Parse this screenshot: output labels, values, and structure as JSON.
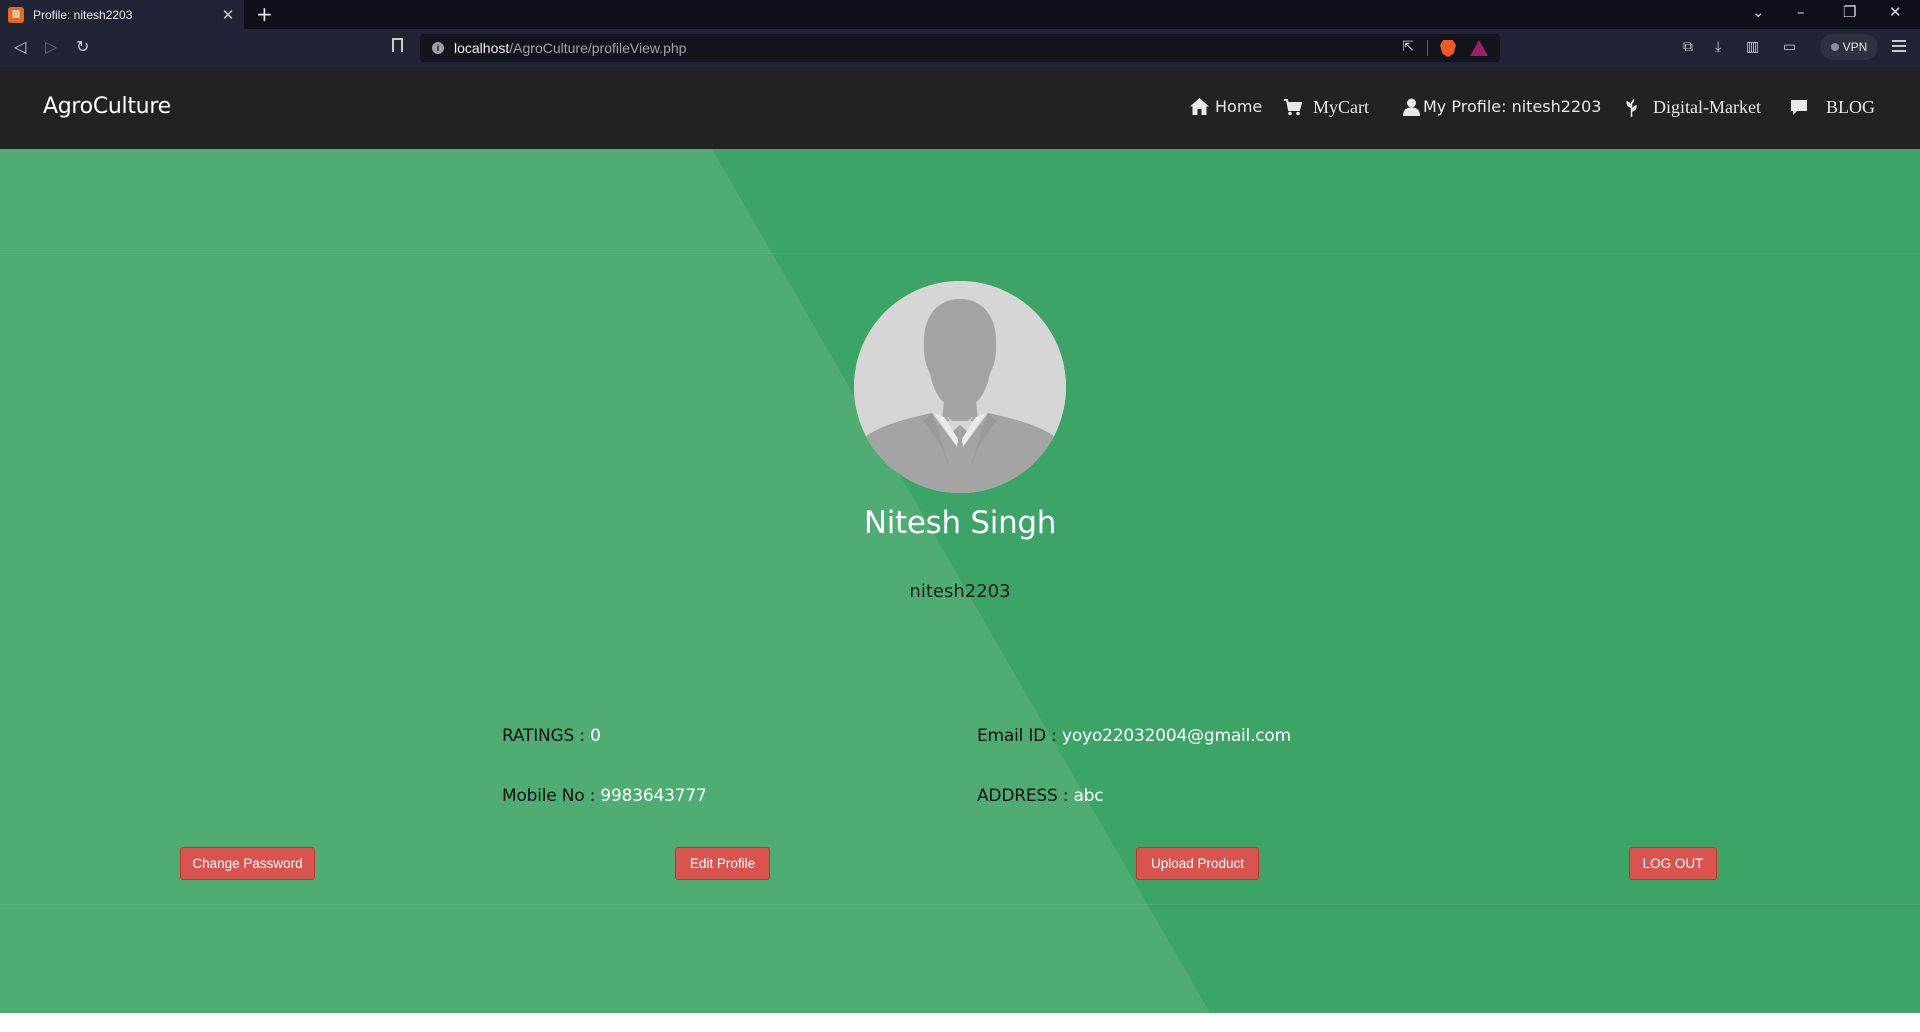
{
  "browser": {
    "tab_title": "Profile: nitesh2203",
    "tab_close": "✕",
    "new_tab": "+",
    "url_host": "localhost",
    "url_path": "/AgroCulture/profileView.php",
    "vpn_label": "VPN"
  },
  "navbar": {
    "brand": "AgroCulture",
    "items": [
      {
        "label": "Home",
        "icon": "home-icon"
      },
      {
        "label": "MyCart",
        "icon": "cart-icon"
      },
      {
        "label": "My Profile: nitesh2203",
        "icon": "user-icon"
      },
      {
        "label": "Digital-Market",
        "icon": "leaf-icon"
      },
      {
        "label": "BLOG",
        "icon": "comment-icon"
      }
    ]
  },
  "profile": {
    "full_name": "Nitesh Singh",
    "username": "nitesh2203",
    "ratings_label": "RATINGS : ",
    "ratings_value": "0",
    "email_label": "Email ID : ",
    "email_value": "yoyo22032004@gmail.com",
    "mobile_label": "Mobile No : ",
    "mobile_value": "9983643777",
    "address_label": "ADDRESS : ",
    "address_value": "abc"
  },
  "actions": {
    "change_password": "Change Password",
    "edit_profile": "Edit Profile",
    "upload_product": "Upload Product",
    "log_out": "LOG OUT"
  },
  "colors": {
    "navbar_bg": "#222222",
    "hero_dark": "#3ca466",
    "hero_light": "#4fad74",
    "button_red": "#d9534f"
  }
}
